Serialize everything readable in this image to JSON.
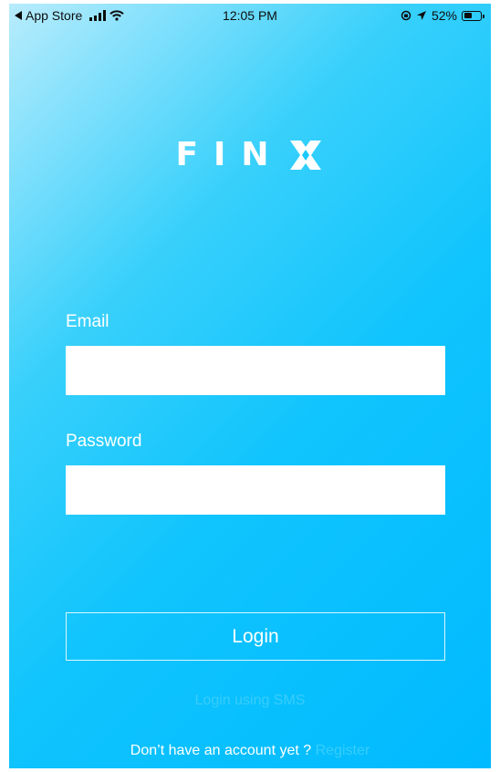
{
  "status_bar": {
    "back_label": "App Store",
    "time": "12:05 PM",
    "battery_percent_label": "52%",
    "battery_level": 0.52
  },
  "logo": {
    "text": "FIN"
  },
  "form": {
    "email_label": "Email",
    "email_value": "",
    "password_label": "Password",
    "password_value": "",
    "login_label": "Login"
  },
  "links": {
    "sms_login": "Login using SMS",
    "no_account_prompt": "Don’t have an account yet ?",
    "register": "Register"
  },
  "colors": {
    "accent": "#00baff",
    "link": "#38cdfb"
  }
}
